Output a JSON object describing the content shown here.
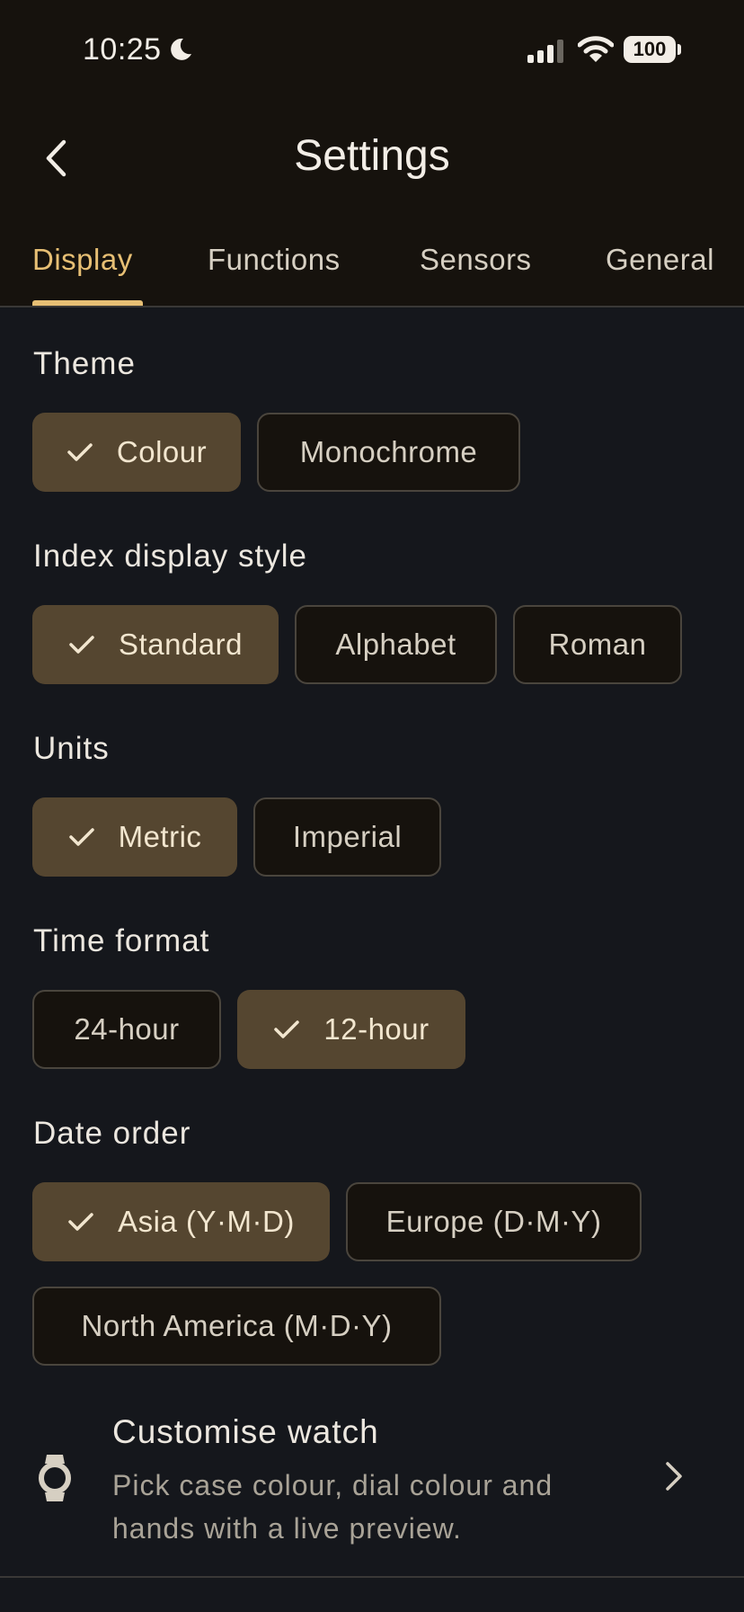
{
  "status_bar": {
    "time": "10:25",
    "battery": "100"
  },
  "header": {
    "title": "Settings"
  },
  "tabs": [
    {
      "label": "Display",
      "active": true
    },
    {
      "label": "Functions",
      "active": false
    },
    {
      "label": "Sensors",
      "active": false
    },
    {
      "label": "General",
      "active": false
    }
  ],
  "sections": {
    "theme": {
      "label": "Theme",
      "options": [
        "Colour",
        "Monochrome"
      ],
      "selected": "Colour"
    },
    "index_style": {
      "label": "Index display style",
      "options": [
        "Standard",
        "Alphabet",
        "Roman"
      ],
      "selected": "Standard"
    },
    "units": {
      "label": "Units",
      "options": [
        "Metric",
        "Imperial"
      ],
      "selected": "Metric"
    },
    "time_format": {
      "label": "Time format",
      "options": [
        "24-hour",
        "12-hour"
      ],
      "selected": "12-hour"
    },
    "date_order": {
      "label": "Date order",
      "options": [
        "Asia (Y·M·D)",
        "Europe (D·M·Y)",
        "North America (M·D·Y)"
      ],
      "selected": "Asia (Y·M·D)"
    }
  },
  "customise": {
    "title": "Customise watch",
    "description": "Pick case colour, dial colour and hands with a live preview."
  },
  "colors": {
    "accent": "#e7bf74",
    "chip_selected": "#554630",
    "background": "#15171c",
    "header_bg": "#16120d"
  }
}
